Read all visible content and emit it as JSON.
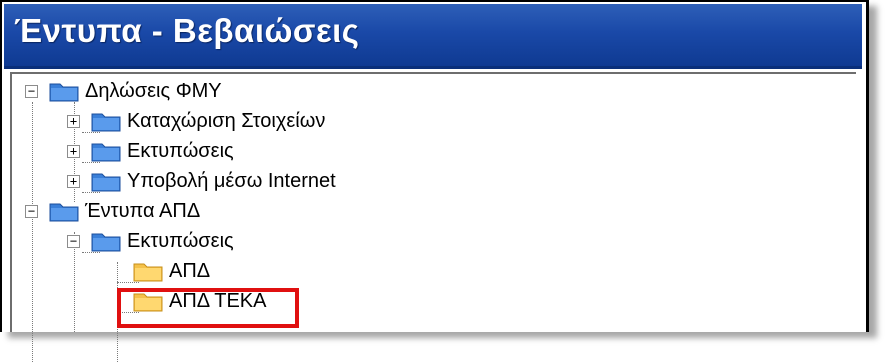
{
  "window": {
    "title": "Έντυπα - Βεβαιώσεις"
  },
  "tree": {
    "items": [
      {
        "label": "Δηλώσεις ΦΜΥ",
        "expander": "−",
        "folder": "blue"
      },
      {
        "label": "Καταχώριση Στοιχείων",
        "expander": "+",
        "folder": "blue"
      },
      {
        "label": "Εκτυπώσεις",
        "expander": "+",
        "folder": "blue"
      },
      {
        "label": "Υποβολή μέσω Internet",
        "expander": "+",
        "folder": "blue"
      },
      {
        "label": "Έντυπα ΑΠΔ",
        "expander": "−",
        "folder": "blue"
      },
      {
        "label": "Εκτυπώσεις",
        "expander": "−",
        "folder": "blue"
      },
      {
        "label": "ΑΠΔ",
        "expander": "",
        "folder": "yellow"
      },
      {
        "label": "ΑΠΔ ΤΕΚΑ",
        "expander": "",
        "folder": "yellow",
        "highlighted": true
      }
    ]
  },
  "colors": {
    "titlebar": "#1a49a8",
    "folder_blue": "#3a7fd8",
    "folder_yellow": "#f5c24a",
    "highlight": "#e01010"
  }
}
